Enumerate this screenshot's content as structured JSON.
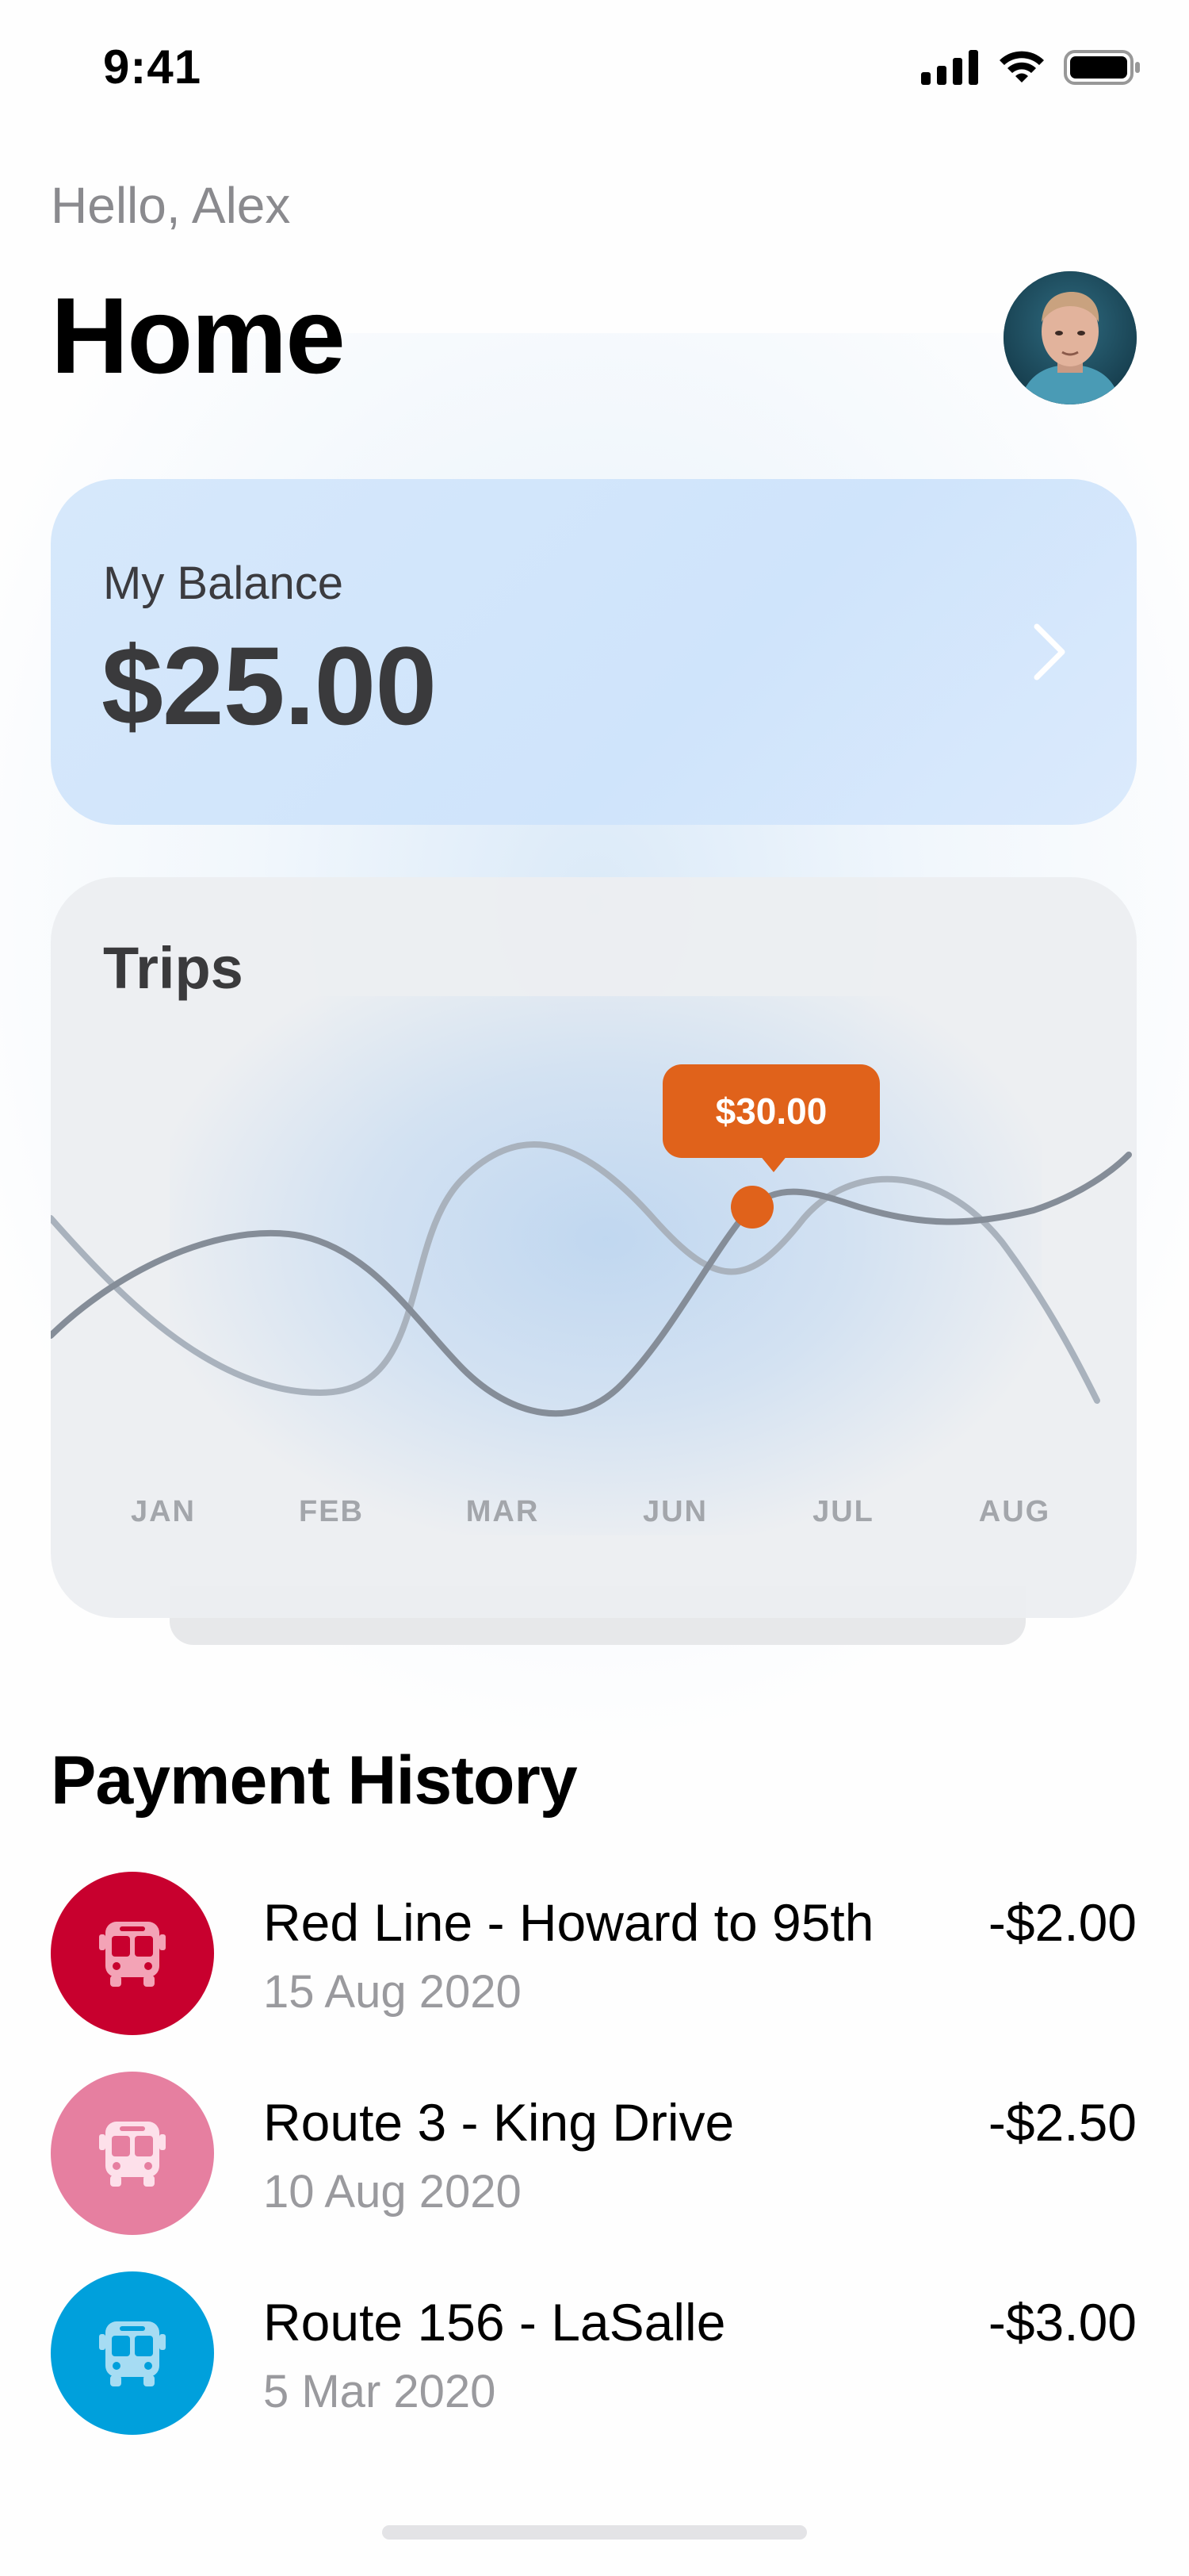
{
  "status_bar": {
    "time": "9:41"
  },
  "header": {
    "greeting": "Hello, Alex",
    "title": "Home"
  },
  "balance": {
    "label": "My Balance",
    "value": "$25.00"
  },
  "trips": {
    "title": "Trips",
    "tooltip": "$30.00",
    "months": [
      "JAN",
      "FEB",
      "MAR",
      "JUN",
      "JUL",
      "AUG"
    ],
    "accent_color": "#e0621b"
  },
  "payment_history": {
    "title": "Payment History",
    "items": [
      {
        "title": "Red Line - Howard to 95th",
        "date": "15 Aug 2020",
        "amount": "-$2.00",
        "color": "#c8002e",
        "icon": "bus-icon"
      },
      {
        "title": "Route 3 - King Drive",
        "date": "10 Aug 2020",
        "amount": "-$2.50",
        "color": "#e67fa0",
        "icon": "bus-icon"
      },
      {
        "title": "Route 156 - LaSalle",
        "date": "5 Mar 2020",
        "amount": "-$3.00",
        "color": "#00a0dc",
        "icon": "bus-icon"
      }
    ]
  }
}
